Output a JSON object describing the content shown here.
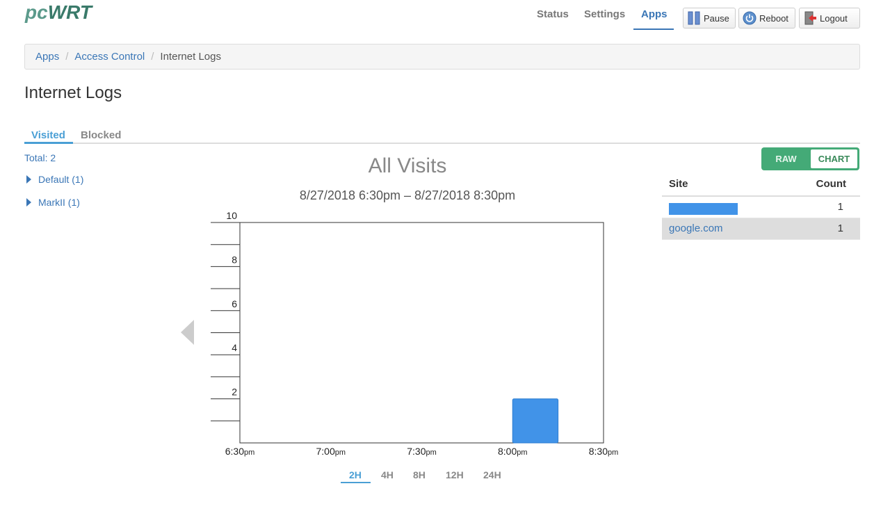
{
  "logo": {
    "pc": "pc",
    "wrt": "WRT"
  },
  "nav": {
    "items": [
      {
        "label": "Status",
        "active": false
      },
      {
        "label": "Settings",
        "active": false
      },
      {
        "label": "Apps",
        "active": true
      }
    ],
    "buttons": [
      {
        "label": "Pause",
        "icon": "pause-icon"
      },
      {
        "label": "Reboot",
        "icon": "power-icon"
      },
      {
        "label": "Logout",
        "icon": "logout-icon"
      }
    ]
  },
  "breadcrumb": [
    "Apps",
    "Access Control",
    "Internet Logs"
  ],
  "page_title": "Internet Logs",
  "tabs": [
    {
      "label": "Visited",
      "active": true
    },
    {
      "label": "Blocked",
      "active": false
    }
  ],
  "sidebar": {
    "total": "Total: 2",
    "groups": [
      {
        "label": "Default (1)"
      },
      {
        "label": "MarkII (1)"
      }
    ]
  },
  "view_toggle": {
    "raw": "RAW",
    "chart": "CHART",
    "selected": "CHART"
  },
  "table": {
    "headers": {
      "site": "Site",
      "count": "Count"
    },
    "rows": [
      {
        "site": "",
        "count": "1",
        "redacted": true
      },
      {
        "site": "google.com",
        "count": "1",
        "redacted": false
      }
    ]
  },
  "ranges": [
    {
      "label": "2H",
      "active": true
    },
    {
      "label": "4H",
      "active": false
    },
    {
      "label": "8H",
      "active": false
    },
    {
      "label": "12H",
      "active": false
    },
    {
      "label": "24H",
      "active": false
    }
  ],
  "colors": {
    "bar": "#4193e8",
    "accent": "#4a9fd5",
    "toggle": "#44aa77",
    "link": "#3a76b6"
  },
  "chart_data": {
    "type": "bar",
    "title": "All Visits",
    "subtitle": "8/27/2018 6:30pm – 8/27/2018 8:30pm",
    "xlabel": "",
    "ylabel": "",
    "ylim": [
      0,
      10
    ],
    "y_ticks": [
      "2",
      "4",
      "6",
      "8",
      "10"
    ],
    "y_minor_tick_step": 1,
    "x_ticks": [
      {
        "time": "6:30",
        "suffix": "pm"
      },
      {
        "time": "7:00",
        "suffix": "pm"
      },
      {
        "time": "7:30",
        "suffix": "pm"
      },
      {
        "time": "8:00",
        "suffix": "pm"
      },
      {
        "time": "8:30",
        "suffix": "pm"
      }
    ],
    "bars": [
      {
        "start": "8:00pm",
        "end": "8:15pm",
        "value": 2
      }
    ],
    "grid": false
  }
}
